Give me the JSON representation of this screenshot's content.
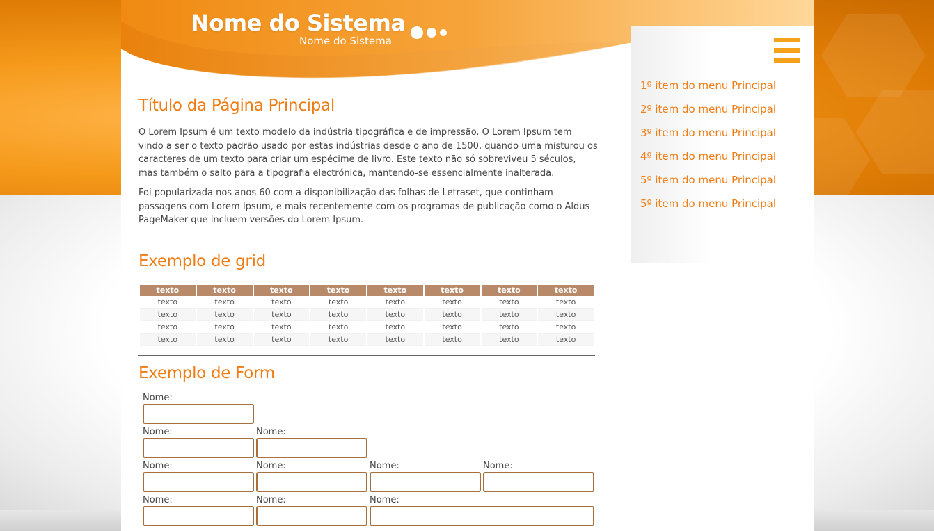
{
  "colors": {
    "accent_orange": "#f07c14",
    "header_orange": "#f5a21a",
    "grid_header": "#b88a6a",
    "input_border": "#a8703f"
  },
  "header": {
    "title": "Nome do Sistema",
    "subtitle": "Nome do Sistema",
    "menu_icon": "hamburger-menu-icon"
  },
  "sidebar": {
    "items": [
      {
        "label": "1º item do menu Principal"
      },
      {
        "label": "2º item do menu Principal"
      },
      {
        "label": "3º item do menu Principal"
      },
      {
        "label": "4º item do menu Principal"
      },
      {
        "label": "5º item do menu Principal"
      },
      {
        "label": "5º item do menu Principal"
      }
    ]
  },
  "main": {
    "title": "Título da Página Principal",
    "paragraphs": [
      "O Lorem Ipsum é um texto modelo da indústria tipográfica e de impressão. O Lorem Ipsum tem vindo a ser o texto padrão usado por estas indústrias desde o ano de 1500, quando uma misturou os caracteres de um texto para criar um espécime de livro. Este texto não só sobreviveu 5 séculos, mas também o salto para a tipografia electrónica, mantendo-se essencialmente inalterada.",
      "Foi popularizada nos anos 60 com a disponibilização das folhas de Letraset, que continham passagens com Lorem Ipsum, e mais recentemente com os programas de publicação como o Aldus PageMaker que incluem versões do Lorem Ipsum."
    ]
  },
  "grid": {
    "title": "Exemplo de grid",
    "headers": [
      "texto",
      "texto",
      "texto",
      "texto",
      "texto",
      "texto",
      "texto",
      "texto"
    ],
    "rows": [
      [
        "texto",
        "texto",
        "texto",
        "texto",
        "texto",
        "texto",
        "texto",
        "texto"
      ],
      [
        "texto",
        "texto",
        "texto",
        "texto",
        "texto",
        "texto",
        "texto",
        "texto"
      ],
      [
        "texto",
        "texto",
        "texto",
        "texto",
        "texto",
        "texto",
        "texto",
        "texto"
      ],
      [
        "texto",
        "texto",
        "texto",
        "texto",
        "texto",
        "texto",
        "texto",
        "texto"
      ]
    ]
  },
  "form": {
    "title": "Exemplo de Form",
    "rows": [
      [
        {
          "label": "Nome:",
          "value": ""
        }
      ],
      [
        {
          "label": "Nome:",
          "value": ""
        },
        {
          "label": "Nome:",
          "value": ""
        }
      ],
      [
        {
          "label": "Nome:",
          "value": ""
        },
        {
          "label": "Nome:",
          "value": ""
        },
        {
          "label": "Nome:",
          "value": ""
        },
        {
          "label": "Nome:",
          "value": ""
        }
      ],
      [
        {
          "label": "Nome:",
          "value": ""
        },
        {
          "label": "Nome:",
          "value": ""
        },
        {
          "label": "Nome:",
          "value": "",
          "wide": true
        }
      ]
    ]
  }
}
